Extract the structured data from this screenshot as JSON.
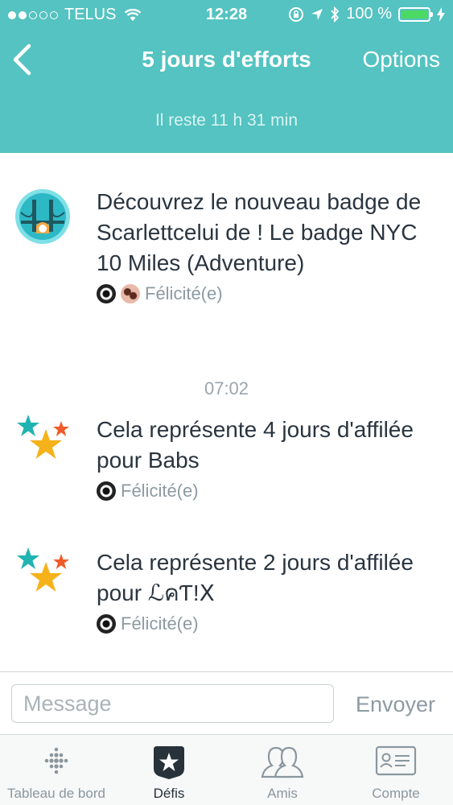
{
  "status_bar": {
    "carrier": "TELUS",
    "time": "12:28",
    "battery": "100 %"
  },
  "nav": {
    "title": "5 jours d'efforts",
    "options_label": "Options",
    "subtitle": "Il reste 11 h 31 min"
  },
  "feed": [
    {
      "text": "Découvrez le nouveau badge de Scarlettcelui de ! Le badge NYC 10 Miles (Adventure)",
      "cheer": "Félicité(e)",
      "icon": "bridge-badge-icon"
    },
    {
      "text": "Cela représente 4 jours d'affilée pour Babs",
      "cheer": "Félicité(e)",
      "icon": "stars-icon"
    },
    {
      "text": "Cela représente 2 jours d'affilée pour ℒคƬ!Ⅹ",
      "cheer": "Félicité(e)",
      "icon": "stars-icon"
    }
  ],
  "time_separator": "07:02",
  "composer": {
    "placeholder": "Message",
    "send_label": "Envoyer"
  },
  "tabs": [
    {
      "label": "Tableau de bord",
      "icon": "dashboard-dots-icon"
    },
    {
      "label": "Défis",
      "icon": "challenge-star-icon",
      "active": true
    },
    {
      "label": "Amis",
      "icon": "friends-icon"
    },
    {
      "label": "Compte",
      "icon": "account-card-icon"
    }
  ],
  "colors": {
    "header": "#54c3c1",
    "battery": "#4cd964",
    "star_teal": "#21b3b1",
    "star_orange": "#f05a28",
    "star_gold": "#f6b21a"
  }
}
